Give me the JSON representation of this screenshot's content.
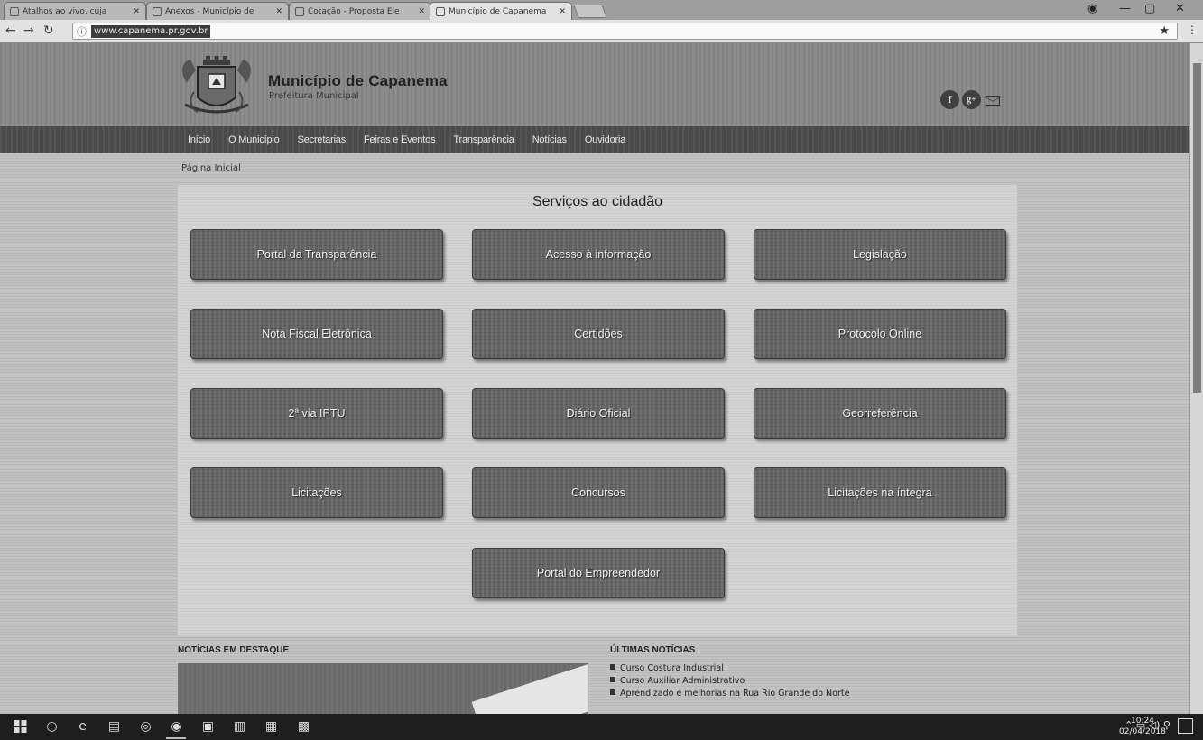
{
  "browser": {
    "tabs": [
      {
        "label": "Atalhos ao vivo, cuja",
        "active": false
      },
      {
        "label": "Anexos - Município de",
        "active": false
      },
      {
        "label": "Cotação - Proposta Ele",
        "active": false
      },
      {
        "label": "Município de Capanema",
        "active": true
      }
    ],
    "url": "www.capanema.pr.gov.br"
  },
  "site": {
    "title": "Município de Capanema",
    "subtitle": "Prefeitura Municipal",
    "social_icons": [
      "facebook-icon",
      "google-plus-icon",
      "mail-icon"
    ],
    "facebook_glyph": "f",
    "google_glyph": "g+"
  },
  "nav": {
    "items": [
      "Início",
      "O Município",
      "Secretarias",
      "Feiras e Eventos",
      "Transparência",
      "Notícias",
      "Ouvidoria"
    ]
  },
  "breadcrumb": "Página Inicial",
  "services": {
    "title": "Serviços ao cidadão",
    "buttons": [
      "Portal da Transparência",
      "Acesso à informação",
      "Legislação",
      "Nota Fiscal Eletrônica",
      "Certidões",
      "Protocolo Online",
      "2ª via IPTU",
      "Diário Oficial",
      "Georreferência",
      "Licitações",
      "Concursos",
      "Licitações na íntegra",
      "Portal do Empreendedor"
    ]
  },
  "news": {
    "featured_title": "NOTÍCIAS EM DESTAQUE",
    "latest_title": "ÚLTIMAS NOTÍCIAS",
    "latest": [
      "Curso Costura Industrial",
      "Curso Auxiliar Administrativo",
      "Aprendizado e melhorias na Rua Rio Grande do Norte"
    ]
  },
  "taskbar": {
    "time": "10:24",
    "date": "02/04/2018"
  }
}
